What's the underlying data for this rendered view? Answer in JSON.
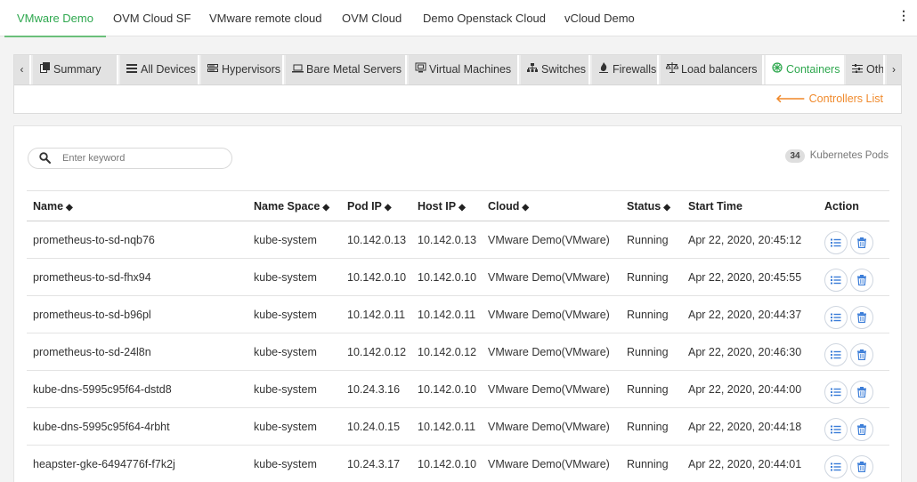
{
  "top_tabs": [
    {
      "label": "VMware Demo",
      "active": true
    },
    {
      "label": "OVM Cloud SF",
      "active": false
    },
    {
      "label": "VMware remote cloud",
      "active": false
    },
    {
      "label": "OVM Cloud",
      "active": false
    },
    {
      "label": "Demo Openstack Cloud",
      "active": false
    },
    {
      "label": "vCloud Demo",
      "active": false
    }
  ],
  "more_menu_icon": "kebab-icon",
  "category_tabs": {
    "prev_arrow": "‹",
    "next_arrow": "›",
    "items": [
      {
        "label": "Summary",
        "icon": "summary-icon"
      },
      {
        "label": "All Devices",
        "icon": "devices-icon"
      },
      {
        "label": "Hypervisors",
        "icon": "hypervisor-icon"
      },
      {
        "label": "Bare Metal Servers",
        "icon": "laptop-icon"
      },
      {
        "label": "Virtual Machines",
        "icon": "virtual-machine-icon"
      },
      {
        "label": "Switches",
        "icon": "sitemap-icon"
      },
      {
        "label": "Firewalls",
        "icon": "fire-icon"
      },
      {
        "label": "Load balancers",
        "icon": "balance-icon"
      },
      {
        "label": "Containers",
        "icon": "container-icon",
        "active": true
      },
      {
        "label": "Other I",
        "icon": "sliders-icon"
      }
    ]
  },
  "controllers_link": {
    "label": "Controllers List",
    "icon": "arrow-left-icon"
  },
  "search": {
    "placeholder": "Enter keyword",
    "value": ""
  },
  "pod_count": {
    "count": "34",
    "label": "Kubernetes Pods"
  },
  "table": {
    "columns": [
      "Name",
      "Name Space",
      "Pod IP",
      "Host IP",
      "Cloud",
      "Status",
      "Start Time",
      "Action"
    ],
    "sortable": [
      true,
      true,
      true,
      true,
      true,
      true,
      false,
      false
    ],
    "rows": [
      {
        "name": "prometheus-to-sd-nqb76",
        "namespace": "kube-system",
        "pod_ip": "10.142.0.13",
        "host_ip": "10.142.0.13",
        "cloud": "VMware Demo(VMware)",
        "status": "Running",
        "start_time": "Apr 22, 2020, 20:45:12"
      },
      {
        "name": "prometheus-to-sd-fhx94",
        "namespace": "kube-system",
        "pod_ip": "10.142.0.10",
        "host_ip": "10.142.0.10",
        "cloud": "VMware Demo(VMware)",
        "status": "Running",
        "start_time": "Apr 22, 2020, 20:45:55"
      },
      {
        "name": "prometheus-to-sd-b96pl",
        "namespace": "kube-system",
        "pod_ip": "10.142.0.11",
        "host_ip": "10.142.0.11",
        "cloud": "VMware Demo(VMware)",
        "status": "Running",
        "start_time": "Apr 22, 2020, 20:44:37"
      },
      {
        "name": "prometheus-to-sd-24l8n",
        "namespace": "kube-system",
        "pod_ip": "10.142.0.12",
        "host_ip": "10.142.0.12",
        "cloud": "VMware Demo(VMware)",
        "status": "Running",
        "start_time": "Apr 22, 2020, 20:46:30"
      },
      {
        "name": "kube-dns-5995c95f64-dstd8",
        "namespace": "kube-system",
        "pod_ip": "10.24.3.16",
        "host_ip": "10.142.0.10",
        "cloud": "VMware Demo(VMware)",
        "status": "Running",
        "start_time": "Apr 22, 2020, 20:44:00"
      },
      {
        "name": "kube-dns-5995c95f64-4rbht",
        "namespace": "kube-system",
        "pod_ip": "10.24.0.15",
        "host_ip": "10.142.0.11",
        "cloud": "VMware Demo(VMware)",
        "status": "Running",
        "start_time": "Apr 22, 2020, 20:44:18"
      },
      {
        "name": "heapster-gke-6494776f-f7k2j",
        "namespace": "kube-system",
        "pod_ip": "10.24.3.17",
        "host_ip": "10.142.0.10",
        "cloud": "VMware Demo(VMware)",
        "status": "Running",
        "start_time": "Apr 22, 2020, 20:44:01"
      }
    ],
    "row_actions": [
      {
        "icon": "list-icon",
        "color": "#3b7dd8"
      },
      {
        "icon": "trash-icon",
        "color": "#3b7dd8"
      }
    ]
  },
  "colors": {
    "accent_green": "#2fa84f",
    "link_orange": "#f08a2c",
    "action_blue": "#3b7dd8"
  }
}
